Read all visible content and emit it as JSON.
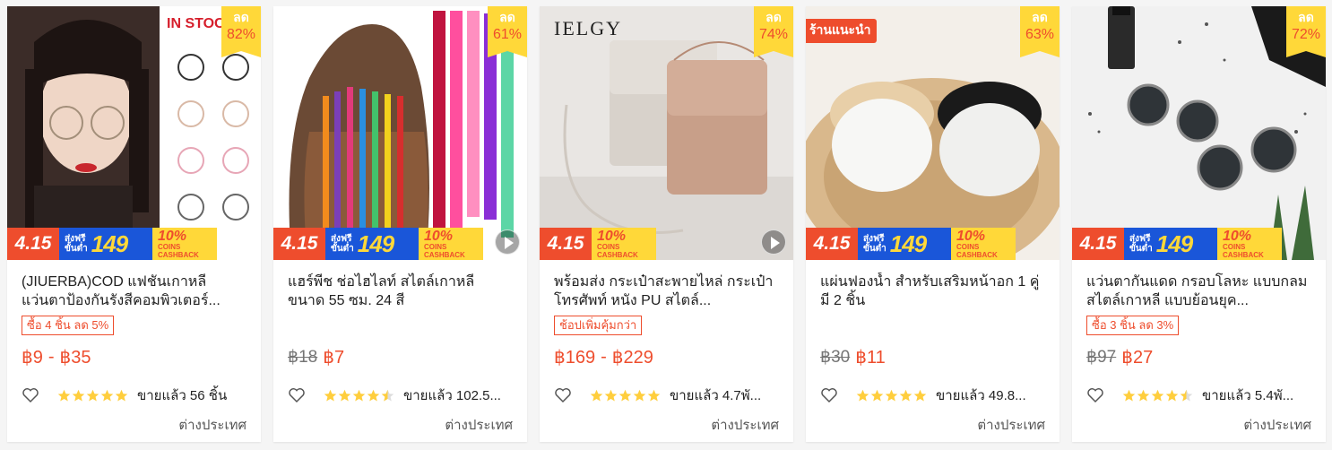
{
  "products": [
    {
      "title": "(JIUERBA)COD แฟชันเกาหลี แว่นตาป้องกันรังสีคอมพิวเตอร์...",
      "discount_label": "ลด",
      "discount_pct": "82%",
      "image_text": "IN STOCK",
      "deal_tag": "ซื้อ 4 ชิ้น ลด 5%",
      "price_low": "฿9",
      "price_high": "฿35",
      "price_old": "",
      "rating": 5,
      "sold": "ขายแล้ว 56 ชิ้น",
      "location": "ต่างประเทศ",
      "has_free_ship": true,
      "has_video": false
    },
    {
      "title": "แฮร์พีช ช่อไฮไลท์ สไตล์เกาหลี ขนาด 55 ซม. 24 สี",
      "discount_label": "ลด",
      "discount_pct": "61%",
      "deal_tag": "",
      "price_low": "฿7",
      "price_high": "",
      "price_old": "฿18",
      "rating": 4.5,
      "sold": "ขายแล้ว 102.5...",
      "location": "ต่างประเทศ",
      "has_free_ship": true,
      "has_video": true
    },
    {
      "title": "พร้อมส่ง กระเป๋าสะพายไหล่ กระเป๋าโทรศัพท์ หนัง PU สไตล์...",
      "discount_label": "ลด",
      "discount_pct": "74%",
      "image_text": "IELGY",
      "deal_tag": "ช้อปเพิ่มคุ้มกว่า",
      "price_low": "฿169",
      "price_high": "฿229",
      "price_old": "",
      "rating": 5,
      "sold": "ขายแล้ว 4.7พั...",
      "location": "ต่างประเทศ",
      "has_free_ship": false,
      "has_video": true
    },
    {
      "title": "แผ่นฟองน้ำ สำหรับเสริมหน้าอก 1 คู่ มี 2 ชิ้น",
      "discount_label": "ลด",
      "discount_pct": "63%",
      "shop_tag": "ร้านแนะนำ",
      "deal_tag": "",
      "price_low": "฿11",
      "price_high": "",
      "price_old": "฿30",
      "rating": 5,
      "sold": "ขายแล้ว 49.8...",
      "location": "ต่างประเทศ",
      "has_free_ship": true,
      "has_video": false
    },
    {
      "title": "แว่นตากันแดด กรอบโลหะ แบบกลม สไตล์เกาหลี แบบย้อนยุค...",
      "discount_label": "ลด",
      "discount_pct": "72%",
      "deal_tag": "ซื้อ 3 ชิ้น ลด 3%",
      "price_low": "฿27",
      "price_high": "",
      "price_old": "฿97",
      "rating": 4.5,
      "sold": "ขายแล้ว 5.4พั...",
      "location": "ต่างประเทศ",
      "has_free_ship": true,
      "has_video": false
    }
  ],
  "promo": {
    "date": "4.15",
    "ship_line1": "ส่งฟรี",
    "ship_line2": "ขั้นต่ำ",
    "ship_amount": "149",
    "cashback_pct": "10%",
    "cashback_line": "COINS CASHBACK"
  },
  "colors": {
    "accent": "#ee4d2d",
    "badge_yellow": "#ffd839",
    "promo_blue": "#1a56d9",
    "star": "#ffce3d"
  }
}
